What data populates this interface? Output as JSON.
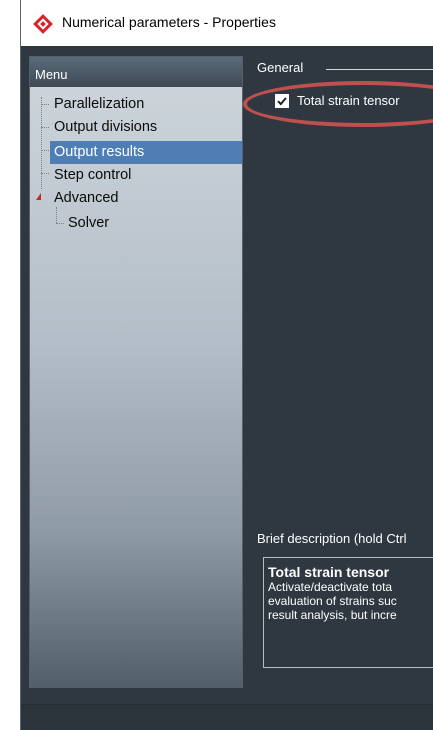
{
  "window": {
    "title": "Numerical parameters - Properties"
  },
  "menu": {
    "header": "Menu",
    "items": [
      {
        "label": "Parallelization"
      },
      {
        "label": "Output divisions"
      },
      {
        "label": "Output results",
        "selected": true
      },
      {
        "label": "Step control"
      },
      {
        "label": "Advanced",
        "expanded": true
      },
      {
        "label": "Solver"
      }
    ]
  },
  "general": {
    "group_label": "General",
    "total_strain_tensor": {
      "label": "Total strain tensor",
      "checked": true
    }
  },
  "description": {
    "label": "Brief description (hold Ctrl",
    "title": "Total strain tensor",
    "lines": [
      "Activate/deactivate tota",
      "evaluation of strains suc",
      "result analysis, but incre"
    ]
  },
  "colors": {
    "selection": "#4f7eb5",
    "highlight_ellipse": "#c0504d",
    "window_bg": "#2f3841"
  },
  "icons": {
    "app_icon": "app-logo-icon",
    "checkmark": "checkmark-icon",
    "expand": "expand-arrow-icon"
  }
}
